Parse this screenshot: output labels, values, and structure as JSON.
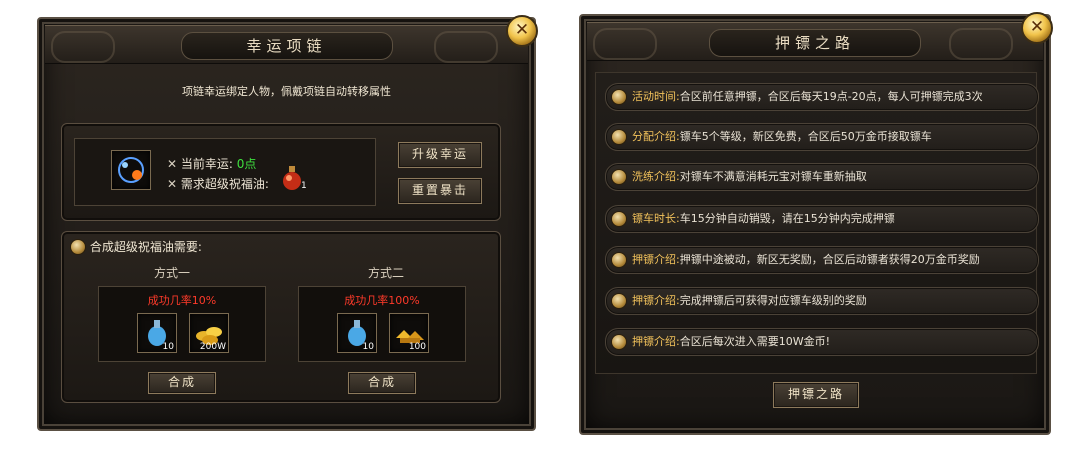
{
  "left": {
    "title": "幸运项链",
    "close": "✕",
    "description": "项链幸运绑定人物，佩戴项链自动转移属性",
    "luck_label": "当前幸运:",
    "luck_value": "0点",
    "oil_label": "需求超级祝福油:",
    "oil_qty": "1",
    "upgrade_btn": "升级幸运",
    "reset_btn": "重置暴击",
    "combine_header": "合成超级祝福油需要:",
    "methods": [
      {
        "title": "方式一",
        "rate": "成功几率10%",
        "item1_qty": "10",
        "item2_qty": "200W",
        "btn": "合成"
      },
      {
        "title": "方式二",
        "rate": "成功几率100%",
        "item1_qty": "10",
        "item2_qty": "100",
        "btn": "合成"
      }
    ]
  },
  "right": {
    "title": "押镖之路",
    "close": "✕",
    "rows": [
      {
        "label": "活动时间:",
        "text": "合区前任意押镖，合区后每天19点-20点，每人可押镖完成3次"
      },
      {
        "label": "分配介绍:",
        "text": "镖车5个等级，新区免费，合区后50万金币接取镖车"
      },
      {
        "label": "洗练介绍:",
        "text": "对镖车不满意消耗元宝对镖车重新抽取"
      },
      {
        "label": "镖车时长:",
        "text": "车15分钟自动销毁，请在15分钟内完成押镖"
      },
      {
        "label": "押镖介绍:",
        "text": "押镖中途被动，新区无奖励，合区后动镖者获得20万金币奖励"
      },
      {
        "label": "押镖介绍:",
        "text": "完成押镖后可获得对应镖车级别的奖励"
      },
      {
        "label": "押镖介绍:",
        "text": "合区后每次进入需要10W金币!"
      }
    ],
    "bottom_btn": "押镖之路"
  },
  "colors": {
    "gold": "#f2c25b",
    "green": "#3ee03e",
    "red": "#ff3a2a"
  },
  "icons": [
    "close-icon",
    "necklace-icon",
    "cross-icon",
    "oil-bottle-icon",
    "scroll-bullet-icon",
    "potion-icon",
    "gold-coins-icon",
    "gold-ingots-icon"
  ]
}
